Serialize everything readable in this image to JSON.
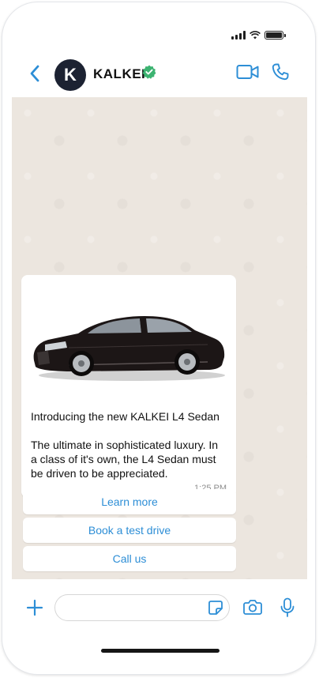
{
  "header": {
    "avatar_letter": "K",
    "contact_name": "KALKEI"
  },
  "message": {
    "title": "Introducing the new KALKEI L4 Sedan",
    "body": "The ultimate in sophisticated luxury. In a class of it's own, the L4 Sedan must be driven to be appreciated.",
    "time": "1:25 PM"
  },
  "buttons": [
    "Learn more",
    "Book a test drive",
    "Call us"
  ],
  "colors": {
    "accent": "#2d8ed6",
    "verified": "#3cb371",
    "chat_bg": "#ece6df",
    "avatar_bg": "#1c2232"
  },
  "icons": [
    "back-arrow-icon",
    "verified-badge-icon",
    "video-call-icon",
    "phone-icon",
    "plus-icon",
    "sticker-icon",
    "camera-icon",
    "microphone-icon"
  ]
}
